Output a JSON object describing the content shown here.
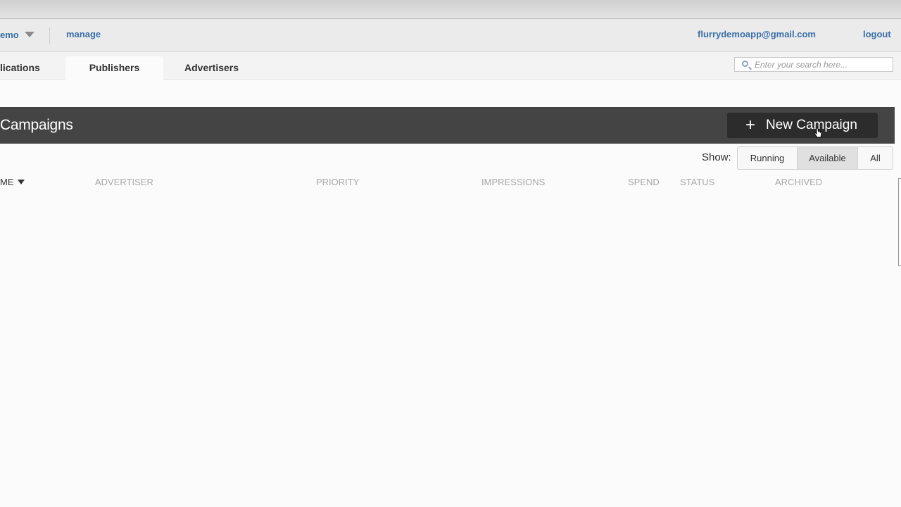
{
  "account": {
    "name_fragment": "emo",
    "manage_label": "manage",
    "email": "flurrydemoapp@gmail.com",
    "logout_label": "logout"
  },
  "tabs": [
    {
      "label": "lications"
    },
    {
      "label": "Publishers",
      "active": true
    },
    {
      "label": "Advertisers"
    }
  ],
  "search": {
    "placeholder": "Enter your search here..."
  },
  "campaigns": {
    "title": "Campaigns",
    "new_button_label": "New Campaign",
    "plus_glyph": "+"
  },
  "filter": {
    "show_label": "Show:",
    "options": [
      "Running",
      "Available",
      "All"
    ],
    "selected": "Available"
  },
  "table": {
    "columns": [
      "ME",
      "ADVERTISER",
      "PRIORITY",
      "IMPRESSIONS",
      "SPEND",
      "STATUS",
      "ARCHIVED"
    ],
    "rows": []
  },
  "colors": {
    "link": "#3a6fa8",
    "header_bar": "#444444",
    "button": "#2c2c2c"
  },
  "icons": [
    "caret-down-icon",
    "search-icon",
    "plus-icon",
    "sort-down-icon",
    "hand-cursor-icon"
  ]
}
